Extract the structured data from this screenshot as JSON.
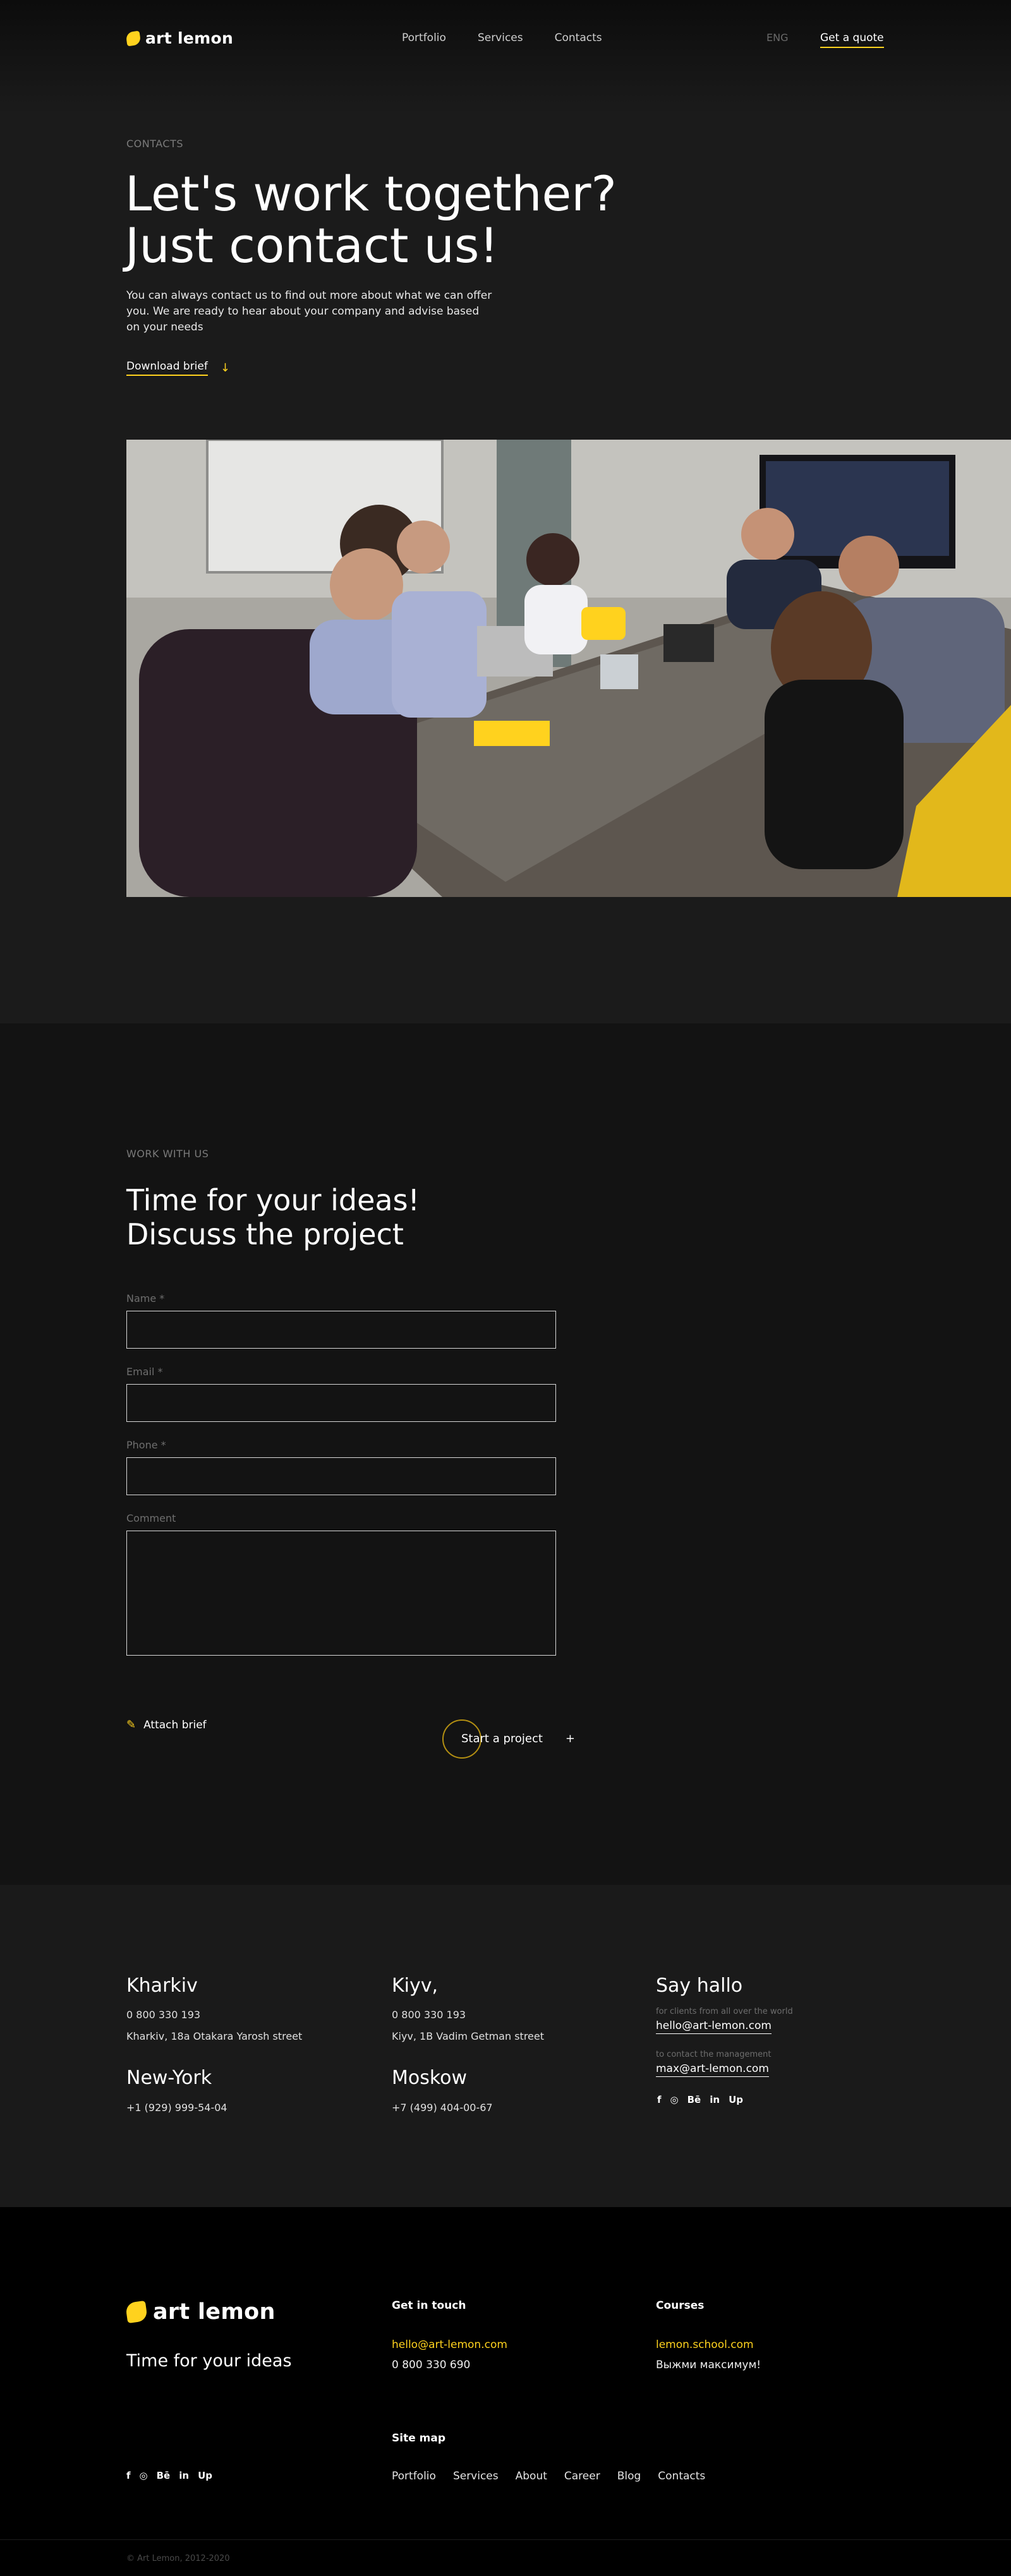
{
  "header": {
    "brand": "art lemon",
    "nav": [
      "Portfolio",
      "Services",
      "Contacts"
    ],
    "lang": "ENG",
    "cta": "Get a quote"
  },
  "hero": {
    "eyebrow": "CONTACTS",
    "title_line1": "Let's work together?",
    "title_line2": "Just contact us!",
    "lead": "You can always contact us to find out more about what we can offer you. We are ready to hear about your company and advise based on your needs",
    "download": "Download brief"
  },
  "work": {
    "eyebrow": "WORK WITH US",
    "title_line1": "Time for your ideas!",
    "title_line2": "Discuss the project",
    "fields": {
      "name": "Name *",
      "email": "Email *",
      "phone": "Phone *",
      "comment": "Comment"
    },
    "attach": "Attach brief",
    "submit": "Start a project",
    "submit_plus": "+"
  },
  "offices": {
    "kharkiv": {
      "city": "Kharkiv",
      "phone": "0 800 330 193",
      "address": "Kharkiv, 18a Otakara Yarosh street"
    },
    "kiyv": {
      "city": "Kiyv,",
      "phone": "0 800 330 193",
      "address": "Kiyv, 1B Vadim Getman street"
    },
    "newyork": {
      "city": "New-York",
      "phone": "+1 (929) 999-54-04"
    },
    "moskow": {
      "city": "Moskow",
      "phone": "+7 (499) 404-00-67"
    },
    "hallo": {
      "title": "Say hallo",
      "clients_note": "for clients from all over the world",
      "clients_mail": "hello@art-lemon.com",
      "mgmt_note": "to contact the management",
      "mgmt_mail": "max@art-lemon.com"
    },
    "socials": [
      "f",
      "◎",
      "Bē",
      "in",
      "Up"
    ]
  },
  "footer": {
    "brand": "art lemon",
    "tagline": "Time for your ideas",
    "touch_title": "Get in touch",
    "touch_mail": "hello@art-lemon.com",
    "touch_phone": "0 800 330 690",
    "courses_title": "Courses",
    "courses_link": "lemon.school.com",
    "courses_slogan": "Выжми максимум!",
    "sitemap_title": "Site map",
    "sitemap": [
      "Portfolio",
      "Services",
      "About",
      "Career",
      "Blog",
      "Contacts"
    ],
    "socials": [
      "f",
      "◎",
      "Bē",
      "in",
      "Up"
    ],
    "copyright": "© Art Lemon, 2012-2020"
  },
  "colors": {
    "accent": "#ffd21e",
    "bg_dark": "#131313",
    "bg": "#1a1a1a",
    "footer": "#000000"
  }
}
